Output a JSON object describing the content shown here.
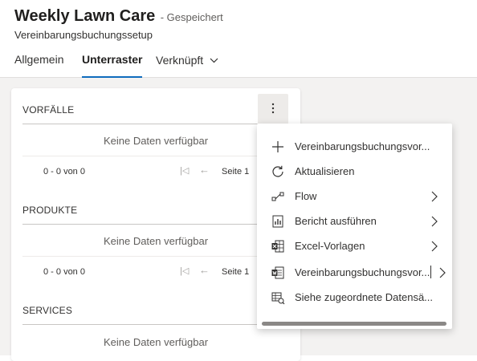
{
  "header": {
    "title": "Weekly Lawn Care",
    "save_status": "- Gespeichert",
    "subtitle": "Vereinbarungsbuchungssetup"
  },
  "tabs": [
    {
      "label": "Allgemein",
      "active": false
    },
    {
      "label": "Unterraster",
      "active": true
    },
    {
      "label": "Verknüpft",
      "active": false
    }
  ],
  "sections": [
    {
      "title": "VORFÄLLE",
      "empty_message": "Keine Daten verfügbar",
      "record_count": "0 - 0 von 0",
      "page_label": "Seite 1"
    },
    {
      "title": "PRODUKTE",
      "empty_message": "Keine Daten verfügbar",
      "record_count": "0 - 0 von 0",
      "page_label": "Seite 1"
    },
    {
      "title": "SERVICES",
      "empty_message": "Keine Daten verfügbar"
    }
  ],
  "menu": {
    "items": [
      {
        "label": "Vereinbarungsbuchungsvor...",
        "icon": "plus-icon",
        "submenu": false
      },
      {
        "label": "Aktualisieren",
        "icon": "refresh-icon",
        "submenu": false
      },
      {
        "label": "Flow",
        "icon": "flow-icon",
        "submenu": true
      },
      {
        "label": "Bericht ausführen",
        "icon": "report-icon",
        "submenu": true
      },
      {
        "label": "Excel-Vorlagen",
        "icon": "excel-icon",
        "submenu": true
      },
      {
        "label": "Vereinbarungsbuchungsvor...",
        "icon": "word-template-icon",
        "submenu": true,
        "split": true
      },
      {
        "label": "Siehe zugeordnete Datensä...",
        "icon": "associated-records-icon",
        "submenu": false
      }
    ]
  },
  "colors": {
    "accent": "#0f6cbd",
    "text": "#323130",
    "muted_text": "#605e5c",
    "background": "#f3f2f1"
  }
}
